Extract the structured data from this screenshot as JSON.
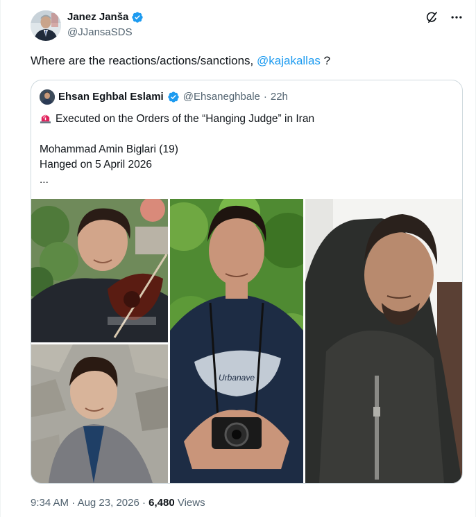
{
  "author": {
    "name": "Janez Janša",
    "handle": "@JJansaSDS"
  },
  "tweet": {
    "text_before": "Where are the reactions/actions/sanctions, ",
    "mention": "@kajakallas",
    "text_after": " ?"
  },
  "quote": {
    "author_name": "Ehsan Eghbal Eslami",
    "author_handle": "@Ehsaneghbale",
    "separator": "·",
    "time": "22h",
    "line1": "Executed on the Orders of the “Hanging Judge” in Iran",
    "line2": "Mohammad Amin Biglari (19)",
    "line3": "Hanged on 5 April 2026",
    "line4": "...",
    "shirt_text": "Urbanave"
  },
  "footer": {
    "time": "9:34 AM",
    "sep1": " · ",
    "date": "Aug 23, 2026",
    "sep2": " · ",
    "views_count": "6,480",
    "views_label": " Views"
  },
  "icons": {
    "verified": "verified-badge-icon",
    "grok": "grok-icon",
    "more": "more-icon",
    "siren": "siren-emoji-icon"
  },
  "colors": {
    "accent": "#1d9bf0",
    "text": "#0f1419",
    "muted": "#536471",
    "border": "#cfd9de"
  }
}
